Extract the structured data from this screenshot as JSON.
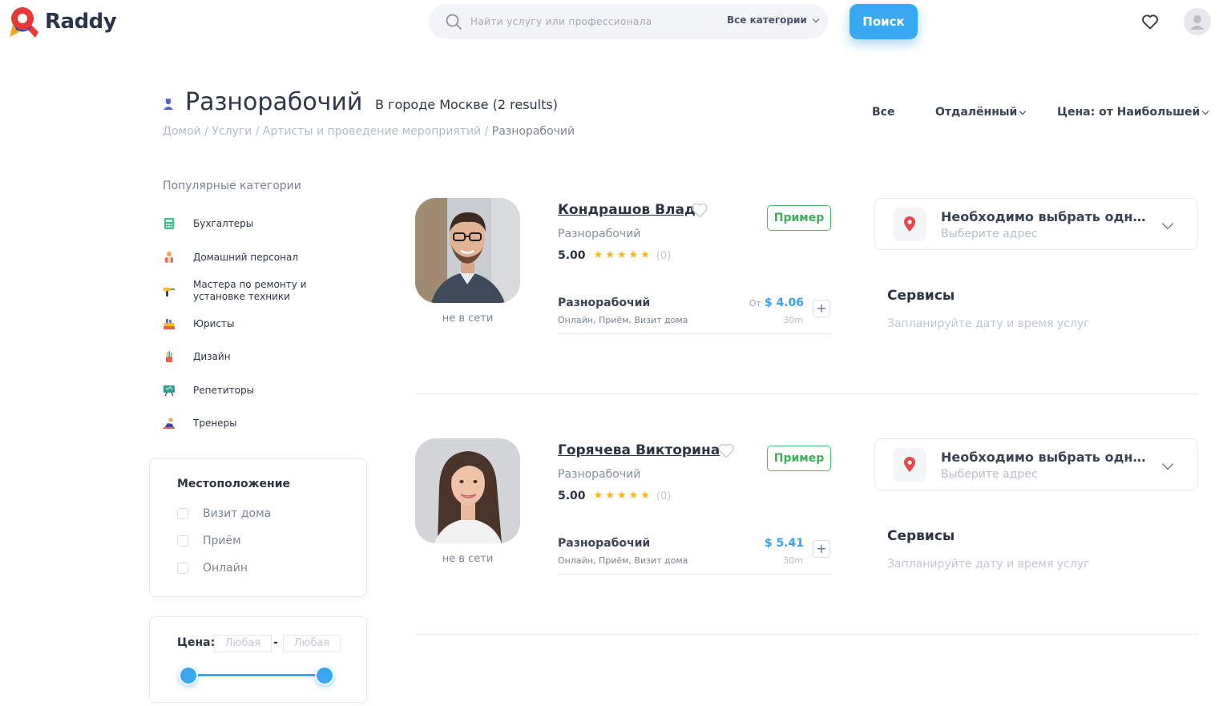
{
  "brand": {
    "name": "Raddy"
  },
  "search": {
    "placeholder": "Найти услугу или профессионала",
    "category": "Все категории",
    "button": "Поиск"
  },
  "page": {
    "title": "Разнорабочий",
    "city_note": "В городе Москве (2 results)",
    "breadcrumb": [
      "Домой",
      "Услуги",
      "Артисты и проведение мероприятий"
    ],
    "breadcrumb_current": "Разнорабочий",
    "separator": " / "
  },
  "top_filters": {
    "all": "Все",
    "remote": "Отдалённый",
    "price_sort": "Цена: от Наибольшей"
  },
  "sidebar": {
    "popular_title": "Популярные категории",
    "categories": [
      {
        "label": "Бухгалтеры",
        "icon": "calculator-icon"
      },
      {
        "label": "Домашний персонал",
        "icon": "housekeeper-icon"
      },
      {
        "label": "Мастера по ремонту и установке техники",
        "icon": "drill-icon"
      },
      {
        "label": "Юристы",
        "icon": "law-books-icon"
      },
      {
        "label": "Дизайн",
        "icon": "design-tools-icon"
      },
      {
        "label": "Репетиторы",
        "icon": "blackboard-icon"
      },
      {
        "label": "Тренеры",
        "icon": "trainer-icon"
      }
    ],
    "location": {
      "title": "Местоположение",
      "options": [
        "Визит дома",
        "Приём",
        "Онлайн"
      ]
    },
    "price": {
      "label": "Цена:",
      "min": "Любая",
      "max": "Любая",
      "dash": "-"
    }
  },
  "results": [
    {
      "name": "Кондрашов Влад",
      "status": "не в сети",
      "tag": "Пример",
      "role": "Разнорабочий",
      "rating": "5.00",
      "stars": 5,
      "reviews": "(0)",
      "service": {
        "name": "Разнорабочий",
        "modes": "Онлайн, Приём, Визит дома",
        "price_prefix": "От",
        "price": "$ 4.06",
        "duration": "30m"
      },
      "address": {
        "title": "Необходимо выбрать одну из локаций",
        "subtitle": "Выберите адрес"
      },
      "services_title": "Сервисы",
      "services_subtitle": "Запланируйте дату и время услуг"
    },
    {
      "name": "Горячева Викторина",
      "status": "не в сети",
      "tag": "Пример",
      "role": "Разнорабочий",
      "rating": "5.00",
      "stars": 5,
      "reviews": "(0)",
      "service": {
        "name": "Разнорабочий",
        "modes": "Онлайн, Приём, Визит дома",
        "price_prefix": "",
        "price": "$ 5.41",
        "duration": "30m"
      },
      "address": {
        "title": "Необходимо выбрать одну из локаций",
        "subtitle": "Выберите адрес"
      },
      "services_title": "Сервисы",
      "services_subtitle": "Запланируйте дату и время услуг"
    }
  ],
  "colors": {
    "accent": "#39a8f2",
    "tag_green": "#3faf5c",
    "star": "#f6b41d",
    "pin_red": "#e5484d"
  }
}
